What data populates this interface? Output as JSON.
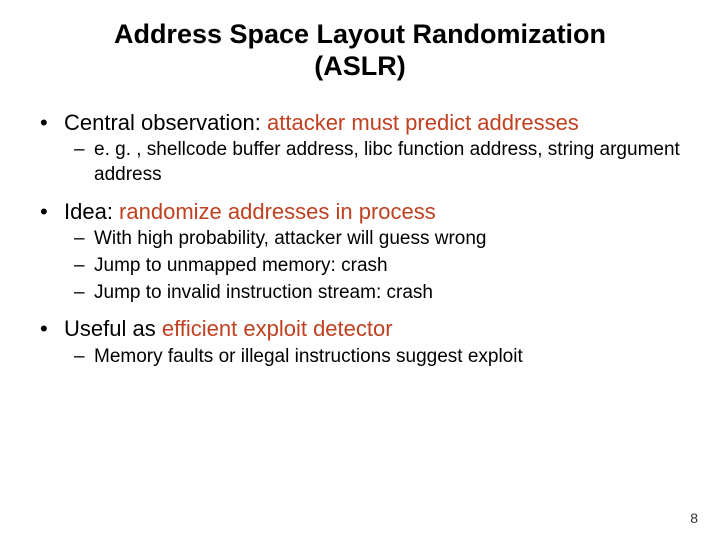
{
  "title_line1": "Address Space Layout Randomization",
  "title_line2": "(ASLR)",
  "bullets": [
    {
      "pre": "Central observation: ",
      "emph": "attacker must predict addresses",
      "post": "",
      "subs": [
        "e. g. , shellcode buffer address, libc function address, string argument address"
      ]
    },
    {
      "pre": "Idea: ",
      "emph": "randomize addresses in process",
      "post": "",
      "subs": [
        "With high probability, attacker will guess wrong",
        "Jump to unmapped memory: crash",
        "Jump to invalid instruction stream: crash"
      ]
    },
    {
      "pre": "Useful as ",
      "emph": "efficient exploit detector",
      "post": "",
      "subs": [
        "Memory faults or illegal instructions suggest exploit"
      ]
    }
  ],
  "page_number": "8"
}
